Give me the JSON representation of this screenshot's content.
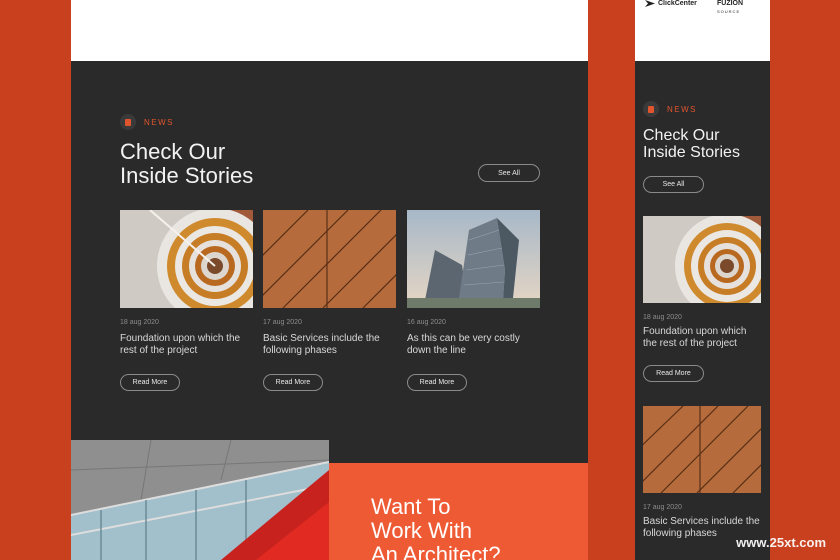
{
  "desktop": {
    "section_tag": "NEWS",
    "section_title": [
      "Check Our",
      "Inside Stories"
    ],
    "see_all_label": "See All",
    "cards": [
      {
        "date": "18 aug 2020",
        "title": "Foundation upon which the rest of the project",
        "read_more": "Read More",
        "image": "spiral-staircase"
      },
      {
        "date": "17 aug 2020",
        "title": "Basic Services include the following phases",
        "read_more": "Read More",
        "image": "copper-facade"
      },
      {
        "date": "16 aug 2020",
        "title": "As this can be very costly down the line",
        "read_more": "Read More",
        "image": "angular-building"
      }
    ],
    "cta_title": [
      "Want To",
      "Work With",
      "An Architect?"
    ]
  },
  "mobile": {
    "logos": [
      "ClickCenter",
      "FUZION"
    ],
    "logo_sub": "SOURCE",
    "section_tag": "NEWS",
    "section_title": [
      "Check Our",
      "Inside Stories"
    ],
    "see_all_label": "See All",
    "cards": [
      {
        "date": "18 aug 2020",
        "title": "Foundation upon which the rest of the project",
        "read_more": "Read More",
        "image": "spiral-staircase"
      },
      {
        "date": "17 aug 2020",
        "title": "Basic Services include the following phases",
        "image": "copper-facade"
      }
    ]
  },
  "watermark": "www.25xt.com",
  "colors": {
    "background": "#c8401e",
    "dark": "#2a2a2a",
    "accent": "#ee5a34",
    "white": "#ffffff"
  }
}
